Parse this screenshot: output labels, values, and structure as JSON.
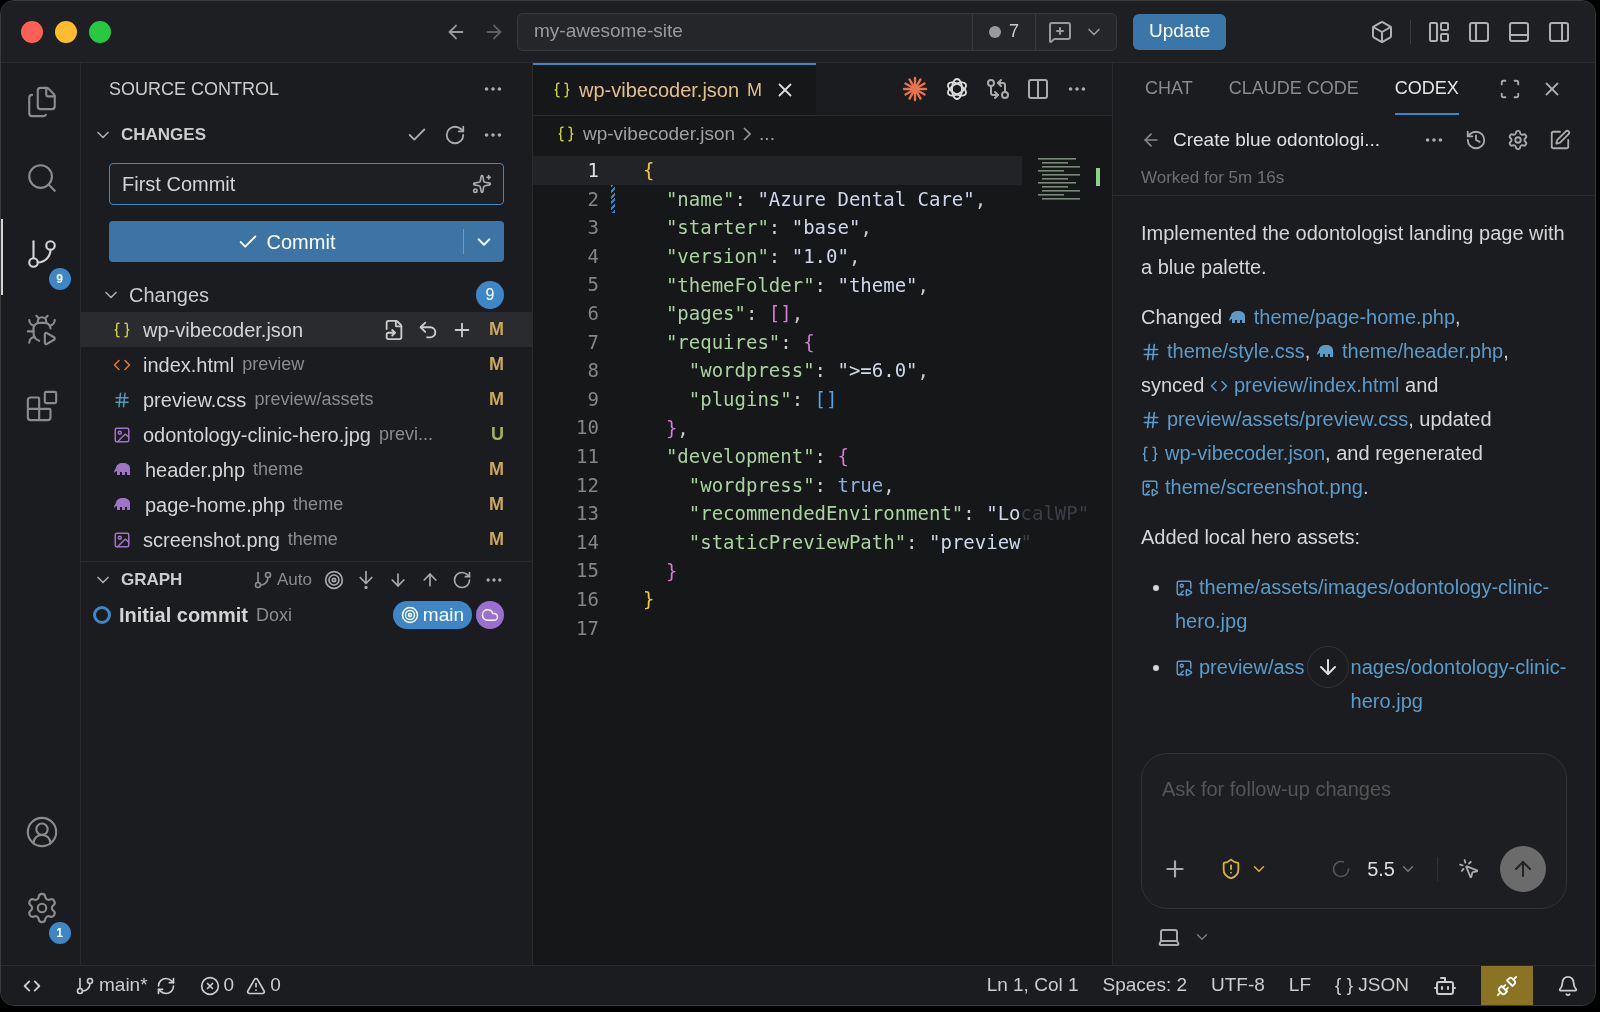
{
  "window": {
    "address": "my-awesome-site",
    "unsaved_count": "7",
    "update_button": "Update"
  },
  "activity_bar": {
    "items": [
      {
        "kind": "files",
        "selected": false
      },
      {
        "kind": "search",
        "selected": false
      },
      {
        "kind": "source-control",
        "selected": true,
        "badge": "9"
      },
      {
        "kind": "run",
        "selected": false
      },
      {
        "kind": "extensions",
        "selected": false
      }
    ],
    "bottom": [
      {
        "kind": "account"
      },
      {
        "kind": "settings",
        "badge": "1"
      }
    ]
  },
  "sidebar": {
    "title": "SOURCE CONTROL",
    "section": "CHANGES",
    "commit_message": "First Commit",
    "commit_button": "Commit",
    "changes_group": {
      "label": "Changes",
      "count": "9",
      "expanded": true
    },
    "files": [
      {
        "name": "wp-vibecoder.json",
        "kind": "json",
        "status": "M",
        "color": "#c9a95c",
        "selected": true
      },
      {
        "name": "index.html",
        "path": "preview",
        "kind": "html",
        "status": "M",
        "color": "#c9a95c",
        "selected": false
      },
      {
        "name": "preview.css",
        "path": "preview/assets",
        "kind": "css",
        "status": "M",
        "color": "#c9a95c",
        "selected": false
      },
      {
        "name": "odontology-clinic-hero.jpg",
        "path": "previ...",
        "kind": "image",
        "status": "U",
        "color": "#a3b35e",
        "selected": false
      },
      {
        "name": "header.php",
        "path": "theme",
        "kind": "php",
        "status": "M",
        "color": "#c9a95c",
        "selected": false
      },
      {
        "name": "page-home.php",
        "path": "theme",
        "kind": "php",
        "status": "M",
        "color": "#c9a95c",
        "selected": false
      },
      {
        "name": "screenshot.png",
        "path": "theme",
        "kind": "image",
        "status": "M",
        "color": "#c9a95c",
        "selected": false
      }
    ],
    "graph": {
      "title": "GRAPH",
      "mode": "Auto",
      "commits": [
        {
          "message": "Initial commit",
          "author": "Doxi",
          "branch": "main"
        }
      ]
    }
  },
  "editor": {
    "tab": {
      "name": "wp-vibecoder.json",
      "status": "M",
      "selected": true
    },
    "breadcrumb": [
      "wp-vibecoder.json",
      "..."
    ],
    "lines": [
      {
        "number": "1",
        "current": true,
        "changed": false,
        "tokens": [
          {
            "t": "{",
            "kind": "b1"
          }
        ]
      },
      {
        "number": "2",
        "current": false,
        "changed": true,
        "tokens": [
          {
            "t": "  \"name\"",
            "kind": "key"
          },
          {
            "t": ": ",
            "kind": "punct"
          },
          {
            "t": "\"Azure Dental Care\"",
            "kind": "string"
          },
          {
            "t": ",",
            "kind": "punct"
          }
        ]
      },
      {
        "number": "3",
        "current": false,
        "changed": false,
        "tokens": [
          {
            "t": "  \"starter\"",
            "kind": "key"
          },
          {
            "t": ": ",
            "kind": "punct"
          },
          {
            "t": "\"base\"",
            "kind": "string"
          },
          {
            "t": ",",
            "kind": "punct"
          }
        ]
      },
      {
        "number": "4",
        "current": false,
        "changed": false,
        "tokens": [
          {
            "t": "  \"version\"",
            "kind": "key"
          },
          {
            "t": ": ",
            "kind": "punct"
          },
          {
            "t": "\"1.0\"",
            "kind": "string"
          },
          {
            "t": ",",
            "kind": "punct"
          }
        ]
      },
      {
        "number": "5",
        "current": false,
        "changed": false,
        "tokens": [
          {
            "t": "  \"themeFolder\"",
            "kind": "key"
          },
          {
            "t": ": ",
            "kind": "punct"
          },
          {
            "t": "\"theme\"",
            "kind": "string"
          },
          {
            "t": ",",
            "kind": "punct"
          }
        ]
      },
      {
        "number": "6",
        "current": false,
        "changed": false,
        "tokens": [
          {
            "t": "  \"pages\"",
            "kind": "key"
          },
          {
            "t": ": ",
            "kind": "punct"
          },
          {
            "t": "[]",
            "kind": "b2"
          },
          {
            "t": ",",
            "kind": "punct"
          }
        ]
      },
      {
        "number": "7",
        "current": false,
        "changed": false,
        "tokens": [
          {
            "t": "  \"requires\"",
            "kind": "key"
          },
          {
            "t": ": ",
            "kind": "punct"
          },
          {
            "t": "{",
            "kind": "b2"
          }
        ]
      },
      {
        "number": "8",
        "current": false,
        "changed": false,
        "tokens": [
          {
            "t": "    \"wordpress\"",
            "kind": "key"
          },
          {
            "t": ": ",
            "kind": "punct"
          },
          {
            "t": "\">=6.0\"",
            "kind": "string"
          },
          {
            "t": ",",
            "kind": "punct"
          }
        ]
      },
      {
        "number": "9",
        "current": false,
        "changed": false,
        "tokens": [
          {
            "t": "    \"plugins\"",
            "kind": "key"
          },
          {
            "t": ": ",
            "kind": "punct"
          },
          {
            "t": "[]",
            "kind": "b3"
          }
        ]
      },
      {
        "number": "10",
        "current": false,
        "changed": false,
        "tokens": [
          {
            "t": "  }",
            "kind": "b2"
          },
          {
            "t": ",",
            "kind": "punct"
          }
        ]
      },
      {
        "number": "11",
        "current": false,
        "changed": false,
        "tokens": [
          {
            "t": "  \"development\"",
            "kind": "key"
          },
          {
            "t": ": ",
            "kind": "punct"
          },
          {
            "t": "{",
            "kind": "b2"
          }
        ]
      },
      {
        "number": "12",
        "current": false,
        "changed": false,
        "tokens": [
          {
            "t": "    \"wordpress\"",
            "kind": "key"
          },
          {
            "t": ": ",
            "kind": "punct"
          },
          {
            "t": "true",
            "kind": "literal"
          },
          {
            "t": ",",
            "kind": "punct"
          }
        ]
      },
      {
        "number": "13",
        "current": false,
        "changed": false,
        "tokens": [
          {
            "t": "    \"recommendedEnvironment\"",
            "kind": "key"
          },
          {
            "t": ": ",
            "kind": "punct"
          },
          {
            "t": "\"Lo",
            "kind": "string"
          },
          {
            "t": "calWP\"",
            "kind": "faded"
          }
        ]
      },
      {
        "number": "14",
        "current": false,
        "changed": false,
        "tokens": [
          {
            "t": "    \"staticPreviewPath\"",
            "kind": "key"
          },
          {
            "t": ": ",
            "kind": "punct"
          },
          {
            "t": "\"preview",
            "kind": "string"
          },
          {
            "t": "\"",
            "kind": "faded"
          }
        ]
      },
      {
        "number": "15",
        "current": false,
        "changed": false,
        "tokens": [
          {
            "t": "  }",
            "kind": "b2"
          }
        ]
      },
      {
        "number": "16",
        "current": false,
        "changed": false,
        "tokens": [
          {
            "t": "}",
            "kind": "b1"
          }
        ]
      },
      {
        "number": "17",
        "current": false,
        "changed": false
      }
    ]
  },
  "assistant": {
    "tabs": [
      {
        "label": "CHAT",
        "selected": false
      },
      {
        "label": "CLAUDE CODE",
        "selected": false
      },
      {
        "label": "CODEX",
        "selected": true
      }
    ],
    "thread_title": "Create blue odontologi...",
    "worked": "Worked for 5m 16s",
    "paragraphs": [
      {
        "segments": [
          {
            "kind": "text",
            "text": "Implemented the odontologist landing page with a blue palette."
          }
        ]
      },
      {
        "segments": [
          {
            "kind": "text",
            "text": "Changed "
          },
          {
            "kind": "php",
            "text": "theme/page-home.php"
          },
          {
            "kind": "text",
            "text": ", "
          },
          {
            "kind": "css",
            "text": "theme/style.css"
          },
          {
            "kind": "text",
            "text": ", "
          },
          {
            "kind": "php",
            "text": "theme/header.php"
          },
          {
            "kind": "text",
            "text": ", synced "
          },
          {
            "kind": "html",
            "text": "preview/index.html"
          },
          {
            "kind": "text",
            "text": " and "
          },
          {
            "kind": "css",
            "text": "preview/assets/preview.css"
          },
          {
            "kind": "text",
            "text": ", updated "
          },
          {
            "kind": "json",
            "text": "wp-vibecoder.json"
          },
          {
            "kind": "text",
            "text": ", and regenerated "
          },
          {
            "kind": "image",
            "text": "theme/screenshot.png"
          },
          {
            "kind": "text",
            "text": "."
          }
        ]
      },
      {
        "segments": [
          {
            "kind": "text",
            "text": "Added local hero assets:"
          }
        ]
      }
    ],
    "bullets": [
      {
        "kind": "image",
        "parts": [
          "theme/assets/images/odontology-clinic-hero.jpg"
        ]
      },
      {
        "kind": "image",
        "parts": [
          "preview/ass",
          "nages/odontology-clinic-hero.jpg"
        ]
      }
    ],
    "composer": {
      "placeholder": "Ask for follow-up changes",
      "model": "5.5"
    }
  },
  "status_bar": {
    "branch": "main*",
    "errors": "0",
    "warnings": "0",
    "position": "Ln 1, Col 1",
    "spaces": "Spaces: 2",
    "encoding": "UTF-8",
    "eol": "LF",
    "language_icon": "{ }",
    "language": "JSON"
  }
}
